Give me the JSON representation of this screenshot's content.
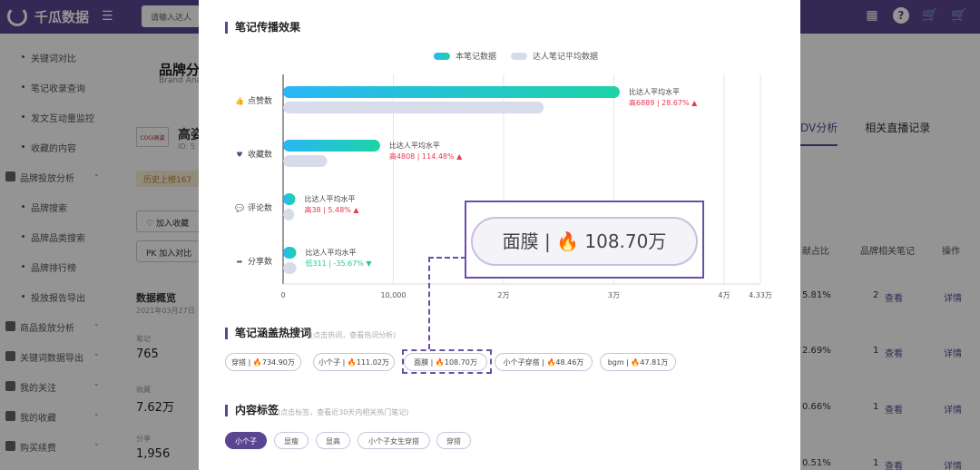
{
  "header": {
    "app_name": "千瓜数据",
    "menu_icon": "menu-icon",
    "search_placeholder": "请输入达人",
    "icons": [
      "grid-icon",
      "help-icon",
      "cart-icon",
      "cart-icon"
    ]
  },
  "sidebar": {
    "items": [
      {
        "label": "关键词对比",
        "type": "sub"
      },
      {
        "label": "笔记收录查询",
        "type": "sub"
      },
      {
        "label": "发文互动量监控",
        "type": "sub"
      },
      {
        "label": "收藏的内容",
        "type": "sub"
      },
      {
        "label": "品牌投放分析",
        "type": "group"
      },
      {
        "label": "品牌搜索",
        "type": "sub"
      },
      {
        "label": "品牌品类搜索",
        "type": "sub"
      },
      {
        "label": "品牌排行榜",
        "type": "sub"
      },
      {
        "label": "投放报告导出",
        "type": "sub"
      },
      {
        "label": "商品投放分析",
        "type": "group"
      },
      {
        "label": "关键词数据导出",
        "type": "group"
      },
      {
        "label": "我的关注",
        "type": "group"
      },
      {
        "label": "我的收藏",
        "type": "group"
      },
      {
        "label": "购买续费",
        "type": "group"
      }
    ]
  },
  "background": {
    "page_title": "品牌分",
    "page_subtitle": "Brand Ana",
    "brand_logo_text": "COGI高姿",
    "brand_name": "高姿",
    "brand_id": "ID: 5",
    "history_badge": "历史上榜167",
    "follow_button": "加入收藏",
    "compare_button": "PK  加入对比",
    "overview_label": "数据概览",
    "overview_date": "2021年03月27日",
    "stats": [
      {
        "label": "笔记",
        "value": "765"
      },
      {
        "label": "收藏",
        "value": "7.62万"
      },
      {
        "label": "分享",
        "value": "1,956"
      }
    ],
    "tabs": [
      "DV分析",
      "相关直播记录"
    ],
    "table_headers": [
      "献占比",
      "品牌相关笔记",
      "操作"
    ],
    "table_rows": [
      {
        "share": "5.81%",
        "count": "2",
        "view": "查看",
        "detail": "详情"
      },
      {
        "share": "2.69%",
        "count": "1",
        "view": "查看",
        "detail": "详情"
      },
      {
        "share": "0.66%",
        "count": "1",
        "view": "查看",
        "detail": "详情"
      },
      {
        "share": "0.51%",
        "count": "1",
        "view": "查看",
        "detail": "详情"
      }
    ]
  },
  "modal": {
    "section1_title": "笔记传播效果",
    "legend": {
      "this_note": "本笔记数据",
      "avg": "达人笔记平均数据"
    },
    "section2_title": "笔记涵盖热搜词",
    "section2_hint": "(点击热词，查看热词分析)",
    "keywords": [
      {
        "word": "穿搭",
        "value": "734.90万"
      },
      {
        "word": "小个子",
        "value": "111.02万"
      },
      {
        "word": "面膜",
        "value": "108.70万"
      },
      {
        "word": "小个子穿搭",
        "value": "48.46万"
      },
      {
        "word": "bgm",
        "value": "47.81万"
      }
    ],
    "section3_title": "内容标签",
    "section3_hint": "(点击标签，查看近30天内相关热门笔记)",
    "tags": [
      "小个子",
      "显瘦",
      "显高",
      "小个子女生穿搭",
      "穿搭"
    ],
    "callout": {
      "word": "面膜",
      "separator": "|",
      "value": "108.70万"
    }
  },
  "colors": {
    "brand_purple": "#5a4592",
    "this_note_start": "#29b6f6",
    "this_note_end": "#1dd3a7",
    "avg_bar": "#d6dcea",
    "up_red": "#e8384f",
    "down_green": "#20c997"
  },
  "chart_data": {
    "type": "bar",
    "orientation": "horizontal",
    "categories": [
      "点赞数",
      "收藏数",
      "评论数",
      "分享数"
    ],
    "category_icons": [
      "thumbs-up-icon",
      "heart-icon",
      "comment-icon",
      "share-icon"
    ],
    "series": [
      {
        "name": "本笔记数据",
        "values": [
          30540,
          8800,
          1110,
          1190
        ]
      },
      {
        "name": "达人笔记平均数据",
        "values": [
          23650,
          4000,
          1000,
          1200
        ]
      }
    ],
    "annotations": [
      {
        "label": "比达人平均水平",
        "detail": "高6889 | 28.67%",
        "direction": "up"
      },
      {
        "label": "比达人平均水平",
        "detail": "高4808 | 114.48%",
        "direction": "up"
      },
      {
        "label": "比达人平均水平",
        "detail": "高38 | 5.48%",
        "direction": "up"
      },
      {
        "label": "比达人平均水平",
        "detail": "低311 | -35.67%",
        "direction": "down"
      }
    ],
    "x_ticks": [
      {
        "value": 0,
        "label": "0"
      },
      {
        "value": 10000,
        "label": "10,000"
      },
      {
        "value": 20000,
        "label": "2万"
      },
      {
        "value": 30000,
        "label": "3万"
      },
      {
        "value": 40000,
        "label": "4万"
      },
      {
        "value": 43300,
        "label": "4.33万"
      }
    ],
    "xlim": [
      0,
      43300
    ],
    "legend_position": "top-center",
    "grid": true
  }
}
